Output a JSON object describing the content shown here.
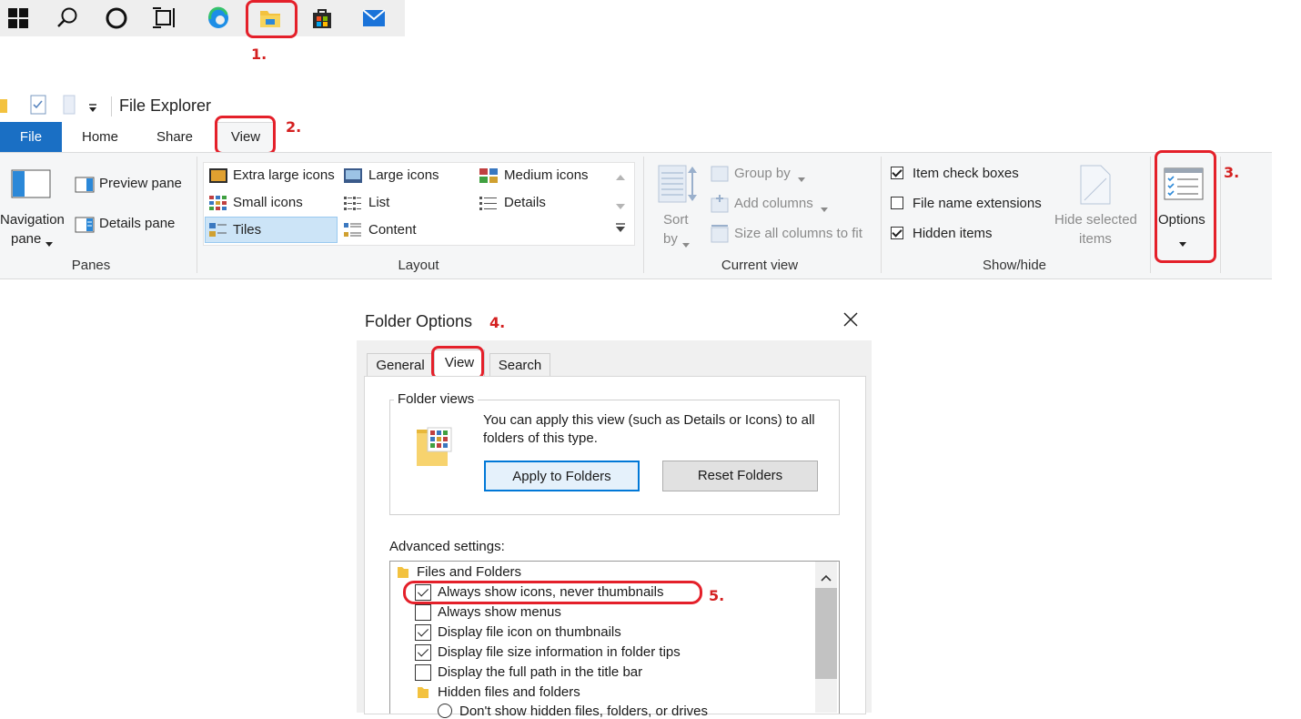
{
  "taskbar": {
    "icons": [
      "windows-start-icon",
      "search-icon",
      "cortana-icon",
      "task-view-icon",
      "edge-icon",
      "file-explorer-icon",
      "store-icon",
      "mail-icon"
    ]
  },
  "steps": {
    "s1": "1.",
    "s2": "2.",
    "s3": "3.",
    "s4": "4.",
    "s5": "5."
  },
  "explorer": {
    "title": "File Explorer",
    "tabs": {
      "file": "File",
      "home": "Home",
      "share": "Share",
      "view": "View"
    },
    "panes": {
      "navigation": "Navigation",
      "navigation2": "pane",
      "preview": "Preview pane",
      "details": "Details pane",
      "label": "Panes"
    },
    "layout": {
      "items": [
        "Extra large icons",
        "Large icons",
        "Medium icons",
        "Small icons",
        "List",
        "Details",
        "Tiles",
        "Content"
      ],
      "label": "Layout",
      "selected": "Tiles"
    },
    "current_view": {
      "sort": "Sort",
      "sort2": "by",
      "group_by": "Group by",
      "add_columns": "Add columns",
      "size_columns": "Size all columns to fit",
      "label": "Current view"
    },
    "show_hide": {
      "item_checkboxes": "Item check boxes",
      "file_ext": "File name extensions",
      "hidden_items": "Hidden items",
      "hide_selected": "Hide selected",
      "hide_selected2": "items",
      "label": "Show/hide"
    },
    "options": {
      "label": "Options"
    }
  },
  "dialog": {
    "title": "Folder Options",
    "close": "✕",
    "tabs": {
      "general": "General",
      "view": "View",
      "search": "Search"
    },
    "folder_views": {
      "legend": "Folder views",
      "text": "You can apply this view (such as Details or Icons) to all folders of this type.",
      "apply": "Apply to Folders",
      "reset": "Reset Folders"
    },
    "advanced_label": "Advanced settings:",
    "tree": {
      "group1": "Files and Folders",
      "items": [
        {
          "label": "Always show icons, never thumbnails",
          "checked": true
        },
        {
          "label": "Always show menus",
          "checked": false
        },
        {
          "label": "Display file icon on thumbnails",
          "checked": true
        },
        {
          "label": "Display file size information in folder tips",
          "checked": true
        },
        {
          "label": "Display the full path in the title bar",
          "checked": false
        }
      ],
      "group2": "Hidden files and folders",
      "radio1": "Don't show hidden files, folders, or drives"
    }
  },
  "colors": {
    "accent": "#1a6fc4",
    "highlight": "#e4202a"
  }
}
